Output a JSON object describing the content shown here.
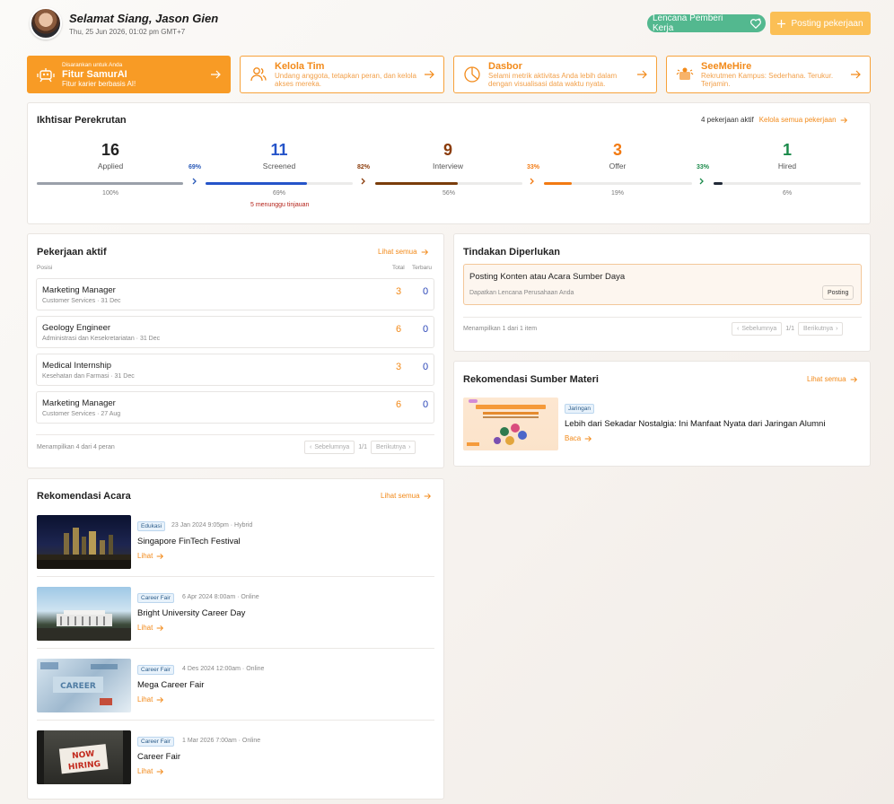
{
  "header": {
    "greeting": "Selamat Siang, Jason Gien",
    "datetime": "Thu, 25 Jun 2026, 01:02 pm GMT+7",
    "badge_label": "Lencana Pemberi Kerja",
    "post_job_label": "Posting pekerjaan"
  },
  "features": [
    {
      "small": "Disarankan untuk Anda",
      "title": "Fitur SamurAI",
      "desc": "Fitur karier berbasis AI!",
      "icon": "robot-icon"
    },
    {
      "title": "Kelola Tim",
      "desc": "Undang anggota, tetapkan peran, dan kelola akses mereka.",
      "icon": "users-icon"
    },
    {
      "title": "Dasbor",
      "desc": "Selami metrik aktivitas Anda lebih dalam dengan visualisasi data waktu nyata.",
      "icon": "dashboard-icon"
    },
    {
      "title": "SeeMeHire",
      "desc": "Rekrutmen Kampus: Sederhana. Terukur. Terjamin.",
      "icon": "seemehire-icon"
    }
  ],
  "overview": {
    "title": "Ikhtisar Perekrutan",
    "active_jobs": "4 pekerjaan aktif",
    "manage_link": "Kelola semua pekerjaan",
    "stages": [
      {
        "count": "16",
        "label": "Applied",
        "pct": "100%",
        "fill": 1.0,
        "color": "#9aa0aa"
      },
      {
        "count": "11",
        "label": "Screened",
        "pct": "69%",
        "fill": 0.69,
        "color": "#2554c9"
      },
      {
        "count": "9",
        "label": "Interview",
        "pct": "56%",
        "fill": 0.56,
        "color": "#7a3d0b"
      },
      {
        "count": "3",
        "label": "Offer",
        "pct": "19%",
        "fill": 0.19,
        "color": "#f27a12"
      },
      {
        "count": "1",
        "label": "Hired",
        "pct": "6%",
        "fill": 0.06,
        "color": "#222a38"
      }
    ],
    "conversions": [
      {
        "value": "69%",
        "color": "#2a5ab8"
      },
      {
        "value": "82%",
        "color": "#8a3b0a"
      },
      {
        "value": "33%",
        "color": "#f27a12"
      },
      {
        "value": "33%",
        "color": "#1a8a4a"
      }
    ],
    "pending": "5 menunggu tinjauan"
  },
  "jobs": {
    "title": "Pekerjaan aktif",
    "see_all": "Lihat semua",
    "col_position": "Posisi",
    "col_total": "Total",
    "col_new": "Terbaru",
    "rows": [
      {
        "title": "Marketing Manager",
        "sub": "Customer Services · 31 Dec",
        "total": "3",
        "new": "0"
      },
      {
        "title": "Geology Engineer",
        "sub": "Administrasi dan Kesekretariatan · 31 Dec",
        "total": "6",
        "new": "0"
      },
      {
        "title": "Medical Internship",
        "sub": "Kesehatan dan Farmasi · 31 Dec",
        "total": "3",
        "new": "0"
      },
      {
        "title": "Marketing Manager",
        "sub": "Customer Services · 27 Aug",
        "total": "6",
        "new": "0"
      }
    ],
    "showing": "Menampilkan 4 dari 4 peran",
    "prev": "Sebelumnya",
    "page": "1/1",
    "next": "Berikutnya"
  },
  "actions": {
    "title": "Tindakan Diperlukan",
    "item_title": "Posting Konten atau Acara Sumber Daya",
    "item_sub": "Dapatkan Lencana Perusahaan Anda",
    "item_button": "Posting",
    "showing": "Menampilkan 1 dari 1 item",
    "prev": "Sebelumnya",
    "page": "1/1",
    "next": "Berikutnya"
  },
  "resources": {
    "title": "Rekomendasi Sumber Materi",
    "see_all": "Lihat semua",
    "tag": "Jaringan",
    "item_title": "Lebih dari Sekadar Nostalgia: Ini Manfaat Nyata dari Jaringan Alumni",
    "read": "Baca"
  },
  "events": {
    "title": "Rekomendasi Acara",
    "see_all": "Lihat semua",
    "view": "Lihat",
    "items": [
      {
        "tag": "Edukasi",
        "meta": "23 Jan 2024 9:05pm · Hybrid",
        "title": "Singapore FinTech Festival"
      },
      {
        "tag": "Career Fair",
        "meta": "6 Apr 2024 8:00am · Online",
        "title": "Bright University Career Day"
      },
      {
        "tag": "Career Fair",
        "meta": "4 Des 2024 12:00am · Online",
        "title": "Mega Career Fair"
      },
      {
        "tag": "Career Fair",
        "meta": "1 Mar 2026 7:00am · Online",
        "title": "Career Fair"
      }
    ]
  },
  "colors": {
    "accent": "#f89b25",
    "badge": "#53b88f",
    "blue": "#2c47b8"
  }
}
